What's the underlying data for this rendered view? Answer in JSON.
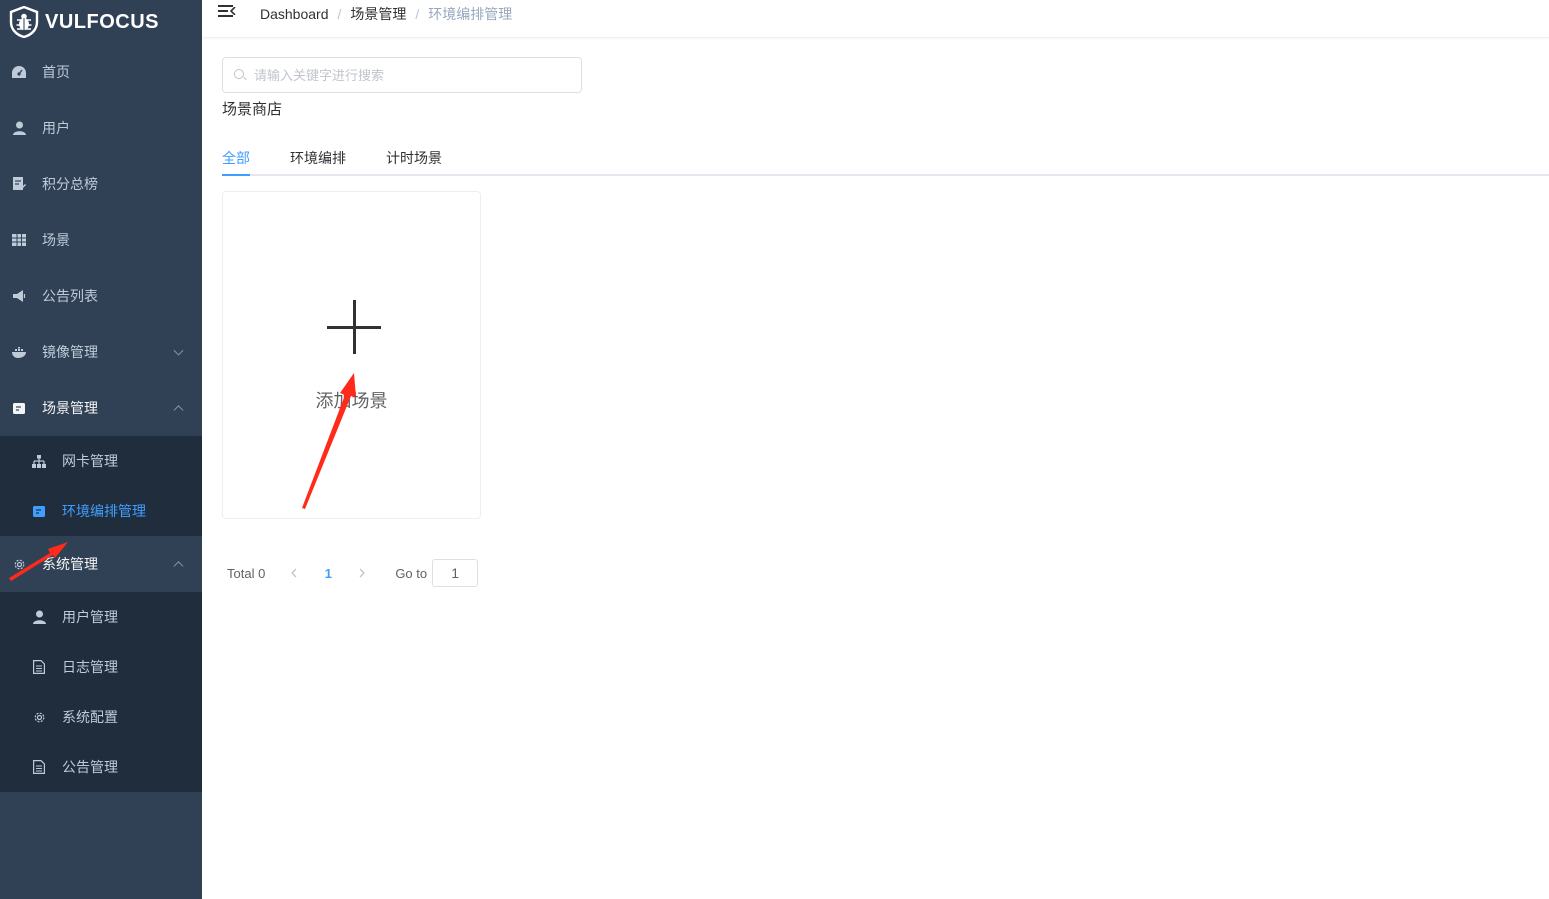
{
  "app": {
    "logo_text": "VULFOCUS"
  },
  "sidebar": {
    "items": [
      {
        "label": "首页",
        "icon": "dashboard-icon"
      },
      {
        "label": "用户",
        "icon": "user-icon"
      },
      {
        "label": "积分总榜",
        "icon": "document-edit-icon"
      },
      {
        "label": "场景",
        "icon": "table-grid-icon"
      },
      {
        "label": "公告列表",
        "icon": "megaphone-icon"
      },
      {
        "label": "镜像管理",
        "icon": "docker-icon",
        "expanded": false
      },
      {
        "label": "场景管理",
        "icon": "scene-card-icon",
        "expanded": true,
        "children": [
          {
            "label": "网卡管理",
            "icon": "network-tree-icon"
          },
          {
            "label": "环境编排管理",
            "icon": "scene-card-icon",
            "active": true
          }
        ]
      },
      {
        "label": "系统管理",
        "icon": "gear-icon",
        "expanded": true,
        "children": [
          {
            "label": "用户管理",
            "icon": "user-icon"
          },
          {
            "label": "日志管理",
            "icon": "document-icon"
          },
          {
            "label": "系统配置",
            "icon": "gear-icon"
          },
          {
            "label": "公告管理",
            "icon": "document-icon"
          }
        ]
      }
    ]
  },
  "breadcrumb": [
    "Dashboard",
    "场景管理",
    "环境编排管理"
  ],
  "search": {
    "placeholder": "请输入关键字进行搜索",
    "value": ""
  },
  "store_title": "场景商店",
  "tabs": [
    {
      "label": "全部",
      "active": true
    },
    {
      "label": "环境编排",
      "active": false
    },
    {
      "label": "计时场景",
      "active": false
    }
  ],
  "add_card": {
    "label": "添加场景"
  },
  "pagination": {
    "total_label": "Total 0",
    "current_page": "1",
    "goto_label": "Go to",
    "goto_value": "1"
  },
  "colors": {
    "sidebar_bg": "#304156",
    "submenu_bg": "#1f2d3d",
    "accent": "#409eff",
    "annotation_arrow": "#ff2a1a"
  }
}
